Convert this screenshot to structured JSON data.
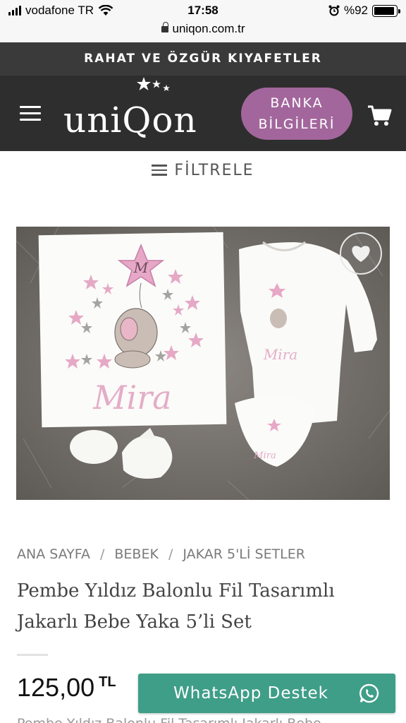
{
  "status_bar": {
    "carrier": "vodafone TR",
    "time": "17:58",
    "battery_label": "%92",
    "battery_level": 0.92
  },
  "browser": {
    "url": "uniqon.com.tr"
  },
  "announcement": {
    "text": "RAHAT VE ÖZGÜR KIYAFETLER"
  },
  "header": {
    "logo_text": "uniQon",
    "bank_button": {
      "line1": "BANKA",
      "line2": "BİLGİLERİ"
    },
    "accent_color": "#a2669c"
  },
  "filter": {
    "label": "FİLTRELE"
  },
  "product_image": {
    "print_name": "Mira",
    "balloon_letter": "M"
  },
  "breadcrumb": {
    "items": [
      "ANA SAYFA",
      "BEBEK",
      "JAKAR 5'Lİ SETLER"
    ],
    "separator": "/"
  },
  "product": {
    "title_line1": "Pembe Yıldız Balonlu Fil Tasarımlı",
    "title_line2": "Jakarlı Bebe Yaka 5’li Set",
    "price": "125,00",
    "currency": "TL",
    "description_partial": "Pembe Yıldız Balonlu Fil Tasarımlı Jakarlı Bebe"
  },
  "whatsapp": {
    "label": "WhatsApp Destek",
    "color": "#3f9e88"
  }
}
